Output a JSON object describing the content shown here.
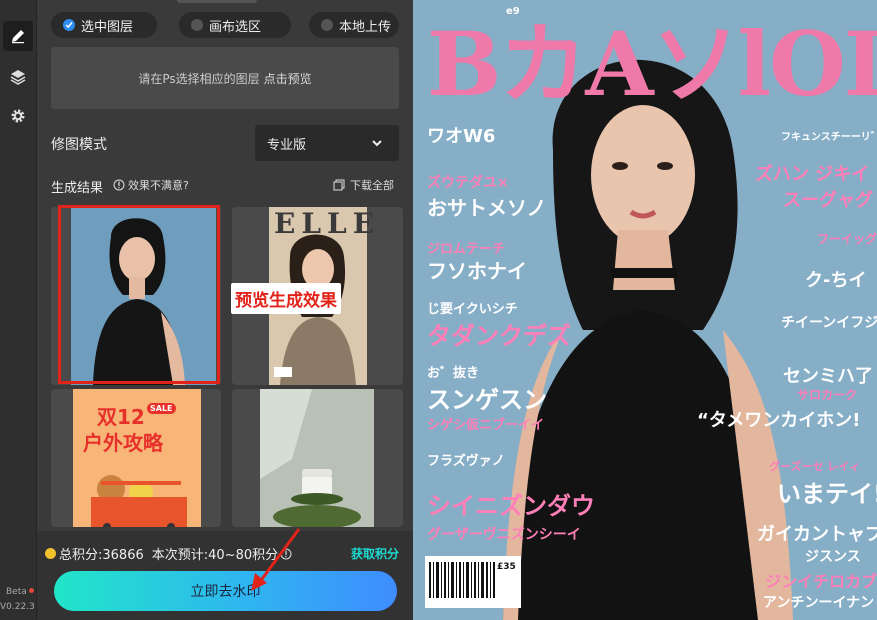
{
  "rail": {
    "icons": [
      "pencil-icon",
      "layers-icon",
      "gear-icon"
    ],
    "beta": "Beta",
    "version": "V0.22.3"
  },
  "source": {
    "options": [
      "选中图层",
      "画布选区",
      "本地上传"
    ],
    "selected": 0,
    "hint": "请在Ps选择相应的图层",
    "preview_link": "点击预览"
  },
  "mode": {
    "label": "修图模式",
    "value": "专业版"
  },
  "results": {
    "title": "生成结果",
    "unsatisfied": "效果不满意?",
    "download_all": "下载全部",
    "callout": "预览生成效果",
    "thumb2_title": "ELLE",
    "thumb3_line1": "双12",
    "thumb3_line2": "户外攻略",
    "thumb3_badge": "SALE"
  },
  "footer": {
    "total_points": "总积分:36866",
    "estimate": "本次预计:40~80积分",
    "get_points": "获取积分",
    "primary_button": "立即去水印"
  },
  "cover": {
    "masthead": "BカAソlOL",
    "issue": "e9",
    "lines": [
      {
        "text": "ワオW6",
        "color": "w"
      },
      {
        "text": "ズウテダユ×",
        "color": "pk"
      },
      {
        "text": "おサトメソノ",
        "color": "w"
      },
      {
        "text": "ジロムテーチ",
        "color": "pk"
      },
      {
        "text": "フソホナイ",
        "color": "w"
      },
      {
        "text": "じ要イクいシチ",
        "color": "w"
      },
      {
        "text": "タダンクデズ",
        "color": "pk"
      },
      {
        "text": "お゛抜き",
        "color": "w"
      },
      {
        "text": "スンゲスン",
        "color": "w"
      },
      {
        "text": "シゲシ仮ニブーイイ",
        "color": "pk"
      },
      {
        "text": "フラズヴァノ",
        "color": "w"
      },
      {
        "text": "シイニズンダウ",
        "color": "pk"
      },
      {
        "text": "グーザーヴニズンシーイ",
        "color": "pk"
      }
    ],
    "right_lines": [
      {
        "text": "フキュンスチーーリ゛ギ",
        "color": "w"
      },
      {
        "text": "ズハン ジキイ",
        "color": "pk"
      },
      {
        "text": "スーグャグ",
        "color": "pk"
      },
      {
        "text": "フーイッグ",
        "color": "pk"
      },
      {
        "text": "ク-ちイ",
        "color": "w"
      },
      {
        "text": "チイーンイフジ",
        "color": "w"
      },
      {
        "text": "センミハ了",
        "color": "w"
      },
      {
        "text": "サロカーク",
        "color": "pk"
      },
      {
        "text": "“タメワンカイホン!",
        "color": "w"
      },
      {
        "text": "グーズーセ レイィ",
        "color": "pk"
      },
      {
        "text": "いまテイ!",
        "color": "w"
      },
      {
        "text": "ガイカントャブ",
        "color": "w"
      },
      {
        "text": "ジスンス",
        "color": "w"
      },
      {
        "text": "ジンイチロカブ",
        "color": "pk"
      },
      {
        "text": "アンチンーイナン",
        "color": "w"
      }
    ],
    "price": "£35"
  },
  "colors": {
    "accent": "#2d8cf0",
    "callout_red": "#e2231a",
    "get_points": "#1dd9d0",
    "masthead_pink": "#ef79a8"
  }
}
